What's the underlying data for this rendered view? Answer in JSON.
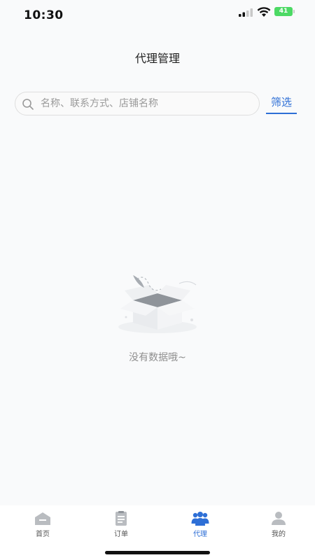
{
  "status_bar": {
    "time": "10:30",
    "battery": "41"
  },
  "header": {
    "title": "代理管理"
  },
  "search": {
    "placeholder": "名称、联系方式、店铺名称",
    "value": "",
    "filter_label": "筛选"
  },
  "empty_state": {
    "message": "没有数据哦~"
  },
  "tab_bar": {
    "items": [
      {
        "label": "首页",
        "icon": "home-icon",
        "active": false
      },
      {
        "label": "订单",
        "icon": "clipboard-icon",
        "active": false
      },
      {
        "label": "代理",
        "icon": "group-icon",
        "active": true
      },
      {
        "label": "我的",
        "icon": "user-icon",
        "active": false
      }
    ]
  },
  "colors": {
    "accent": "#2e6fd6",
    "background": "#f9fafb",
    "battery": "#4cd964"
  }
}
